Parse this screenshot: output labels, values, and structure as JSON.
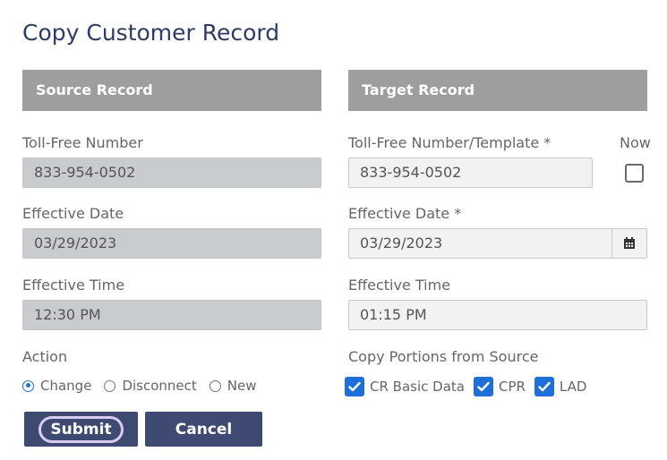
{
  "page": {
    "title": "Copy Customer Record"
  },
  "source": {
    "heading": "Source Record",
    "toll_free_label": "Toll-Free Number",
    "toll_free_value": "833-954-0502",
    "eff_date_label": "Effective Date",
    "eff_date_value": "03/29/2023",
    "eff_time_label": "Effective Time",
    "eff_time_value": "12:30 PM"
  },
  "target": {
    "heading": "Target Record",
    "toll_free_label": "Toll-Free Number/Template *",
    "toll_free_value": "833-954-0502",
    "now_label": "Now",
    "now_checked": false,
    "eff_date_label": "Effective Date *",
    "eff_date_value": "03/29/2023",
    "eff_time_label": "Effective Time",
    "eff_time_value": "01:15 PM"
  },
  "action": {
    "label": "Action",
    "options": [
      {
        "label": "Change",
        "selected": true
      },
      {
        "label": "Disconnect",
        "selected": false
      },
      {
        "label": "New",
        "selected": false
      }
    ]
  },
  "copy_portions": {
    "label": "Copy Portions from Source",
    "options": [
      {
        "label": "CR Basic Data",
        "checked": true
      },
      {
        "label": "CPR",
        "checked": true
      },
      {
        "label": "LAD",
        "checked": true
      }
    ]
  },
  "buttons": {
    "submit": "Submit",
    "cancel": "Cancel"
  },
  "icons": {
    "calendar": "calendar-icon",
    "check": "checkmark-icon"
  },
  "colors": {
    "accent": "#1e6fd9",
    "button": "#3f4a72",
    "header": "#9e9e9e",
    "title": "#2f3a66"
  }
}
